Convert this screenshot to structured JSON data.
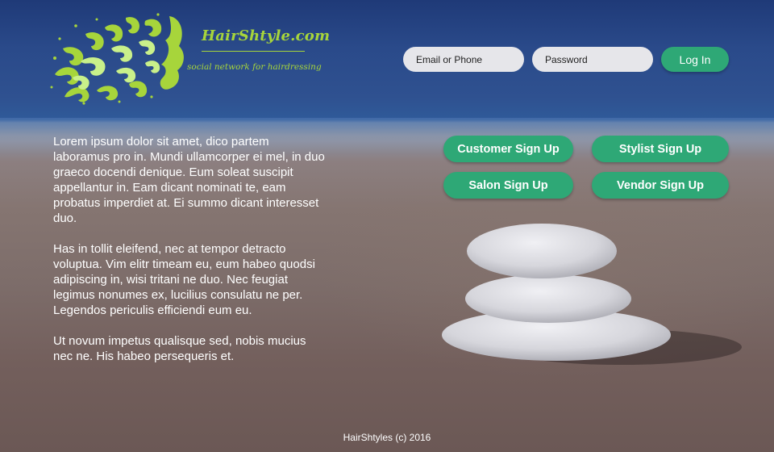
{
  "brand": {
    "name": "HairShtyle.com",
    "tagline": "social network for hairdressing"
  },
  "login": {
    "email_placeholder": "Email or Phone",
    "password_placeholder": "Password",
    "login_label": "Log In"
  },
  "intro_paragraphs": [
    "Lorem ipsum dolor sit amet, dico partem laboramus pro in. Mundi ullamcorper ei mel, in duo graeco docendi denique. Eum soleat suscipit appellantur in. Eam dicant nominati te, eam probatus imperdiet at. Ei summo dicant interesset duo.",
    "Has in tollit eleifend, nec at tempor detracto voluptua. Vim elitr timeam eu, eum habeo quodsi adipiscing in, wisi tritani ne duo. Nec feugiat legimus nonumes ex, lucilius consulatu ne per. Legendos periculis efficiendi eum eu.",
    "Ut novum impetus qualisque sed, nobis mucius nec ne. His habeo persequeris et."
  ],
  "signup": {
    "customer": "Customer Sign Up",
    "stylist": "Stylist Sign Up",
    "salon": "Salon Sign Up",
    "vendor": "Vendor Sign Up"
  },
  "footer": "HairShtyles (c) 2016",
  "colors": {
    "accent_green": "#2ea876",
    "logo_green": "#a7d53b",
    "logo_light_green": "#c9f08a"
  }
}
